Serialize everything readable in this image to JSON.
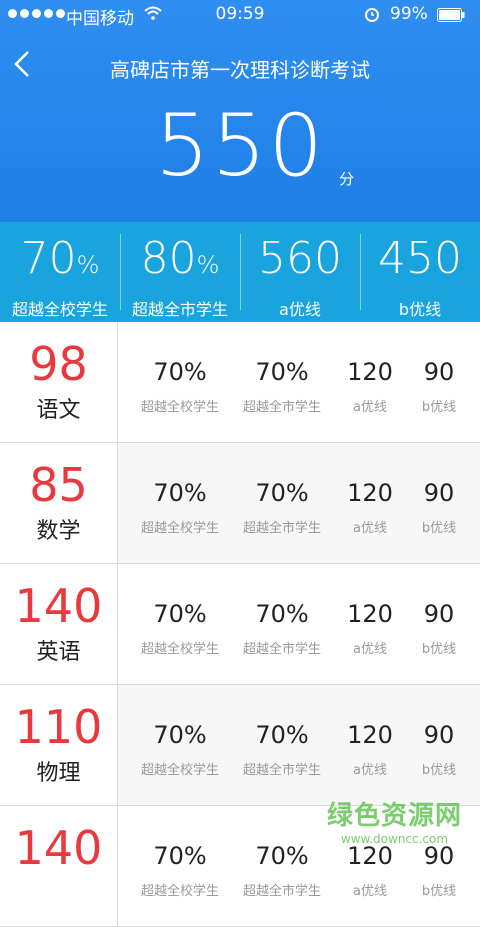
{
  "status": {
    "carrier": "中国移动",
    "time": "09:59",
    "battery": "99%"
  },
  "header": {
    "title": "高碑店市第一次理科诊断考试",
    "total_score": "550",
    "unit": "分"
  },
  "summary": [
    {
      "value": "70",
      "suffix": "%",
      "label": "超越全校学生"
    },
    {
      "value": "80",
      "suffix": "%",
      "label": "超越全市学生"
    },
    {
      "value": "560",
      "suffix": "",
      "label": "a优线"
    },
    {
      "value": "450",
      "suffix": "",
      "label": "b优线"
    }
  ],
  "stat_labels": [
    "超越全校学生",
    "超越全市学生",
    "a优线",
    "b优线"
  ],
  "subjects": [
    {
      "score": "98",
      "name": "语文",
      "stats": [
        "70%",
        "70%",
        "120",
        "90"
      ]
    },
    {
      "score": "85",
      "name": "数学",
      "stats": [
        "70%",
        "70%",
        "120",
        "90"
      ]
    },
    {
      "score": "140",
      "name": "英语",
      "stats": [
        "70%",
        "70%",
        "120",
        "90"
      ]
    },
    {
      "score": "110",
      "name": "物理",
      "stats": [
        "70%",
        "70%",
        "120",
        "90"
      ]
    },
    {
      "score": "140",
      "name": "",
      "stats": [
        "70%",
        "70%",
        "120",
        "90"
      ]
    }
  ],
  "watermark": {
    "title": "绿色资源网",
    "url": "www.downcc.com"
  },
  "colors": {
    "header": "#2f8ef0",
    "summary": "#1aa4dd",
    "score": "#e83a3e"
  },
  "icons": [
    "back-arrow-icon",
    "wifi-icon",
    "alarm-icon",
    "battery-icon"
  ]
}
